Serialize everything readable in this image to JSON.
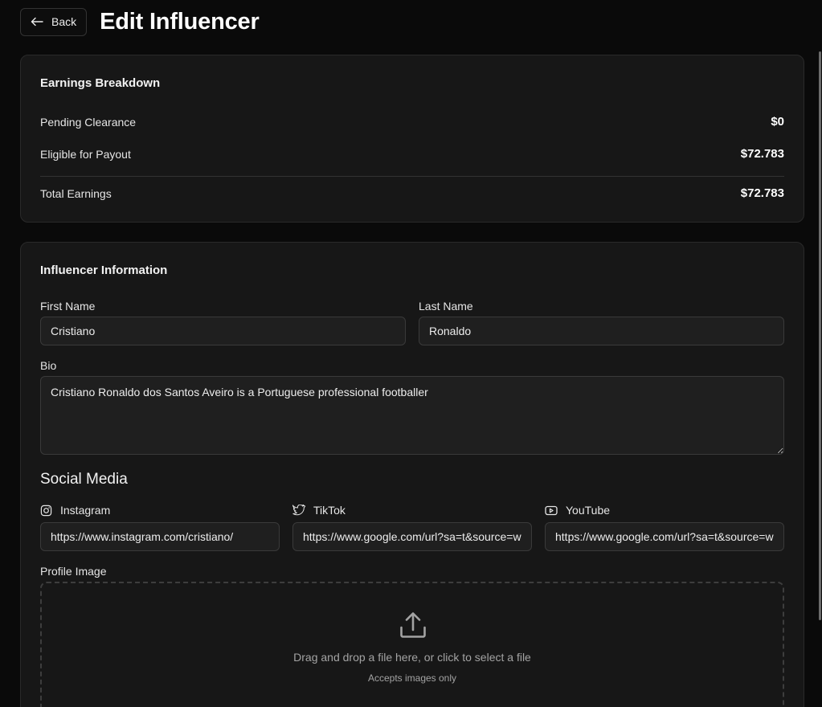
{
  "header": {
    "back_label": "Back",
    "title": "Edit Influencer"
  },
  "earnings": {
    "title": "Earnings Breakdown",
    "rows": [
      {
        "label": "Pending Clearance",
        "value": "$0"
      },
      {
        "label": "Eligible for Payout",
        "value": "$72.783"
      },
      {
        "label": "Total Earnings",
        "value": "$72.783"
      }
    ]
  },
  "info": {
    "title": "Influencer Information",
    "first_name": {
      "label": "First Name",
      "value": "Cristiano"
    },
    "last_name": {
      "label": "Last Name",
      "value": "Ronaldo"
    },
    "bio": {
      "label": "Bio",
      "value": "Cristiano Ronaldo dos Santos Aveiro is a Portuguese professional footballer"
    },
    "social_heading": "Social Media",
    "social": [
      {
        "label": "Instagram",
        "icon": "instagram-icon",
        "value": "https://www.instagram.com/cristiano/"
      },
      {
        "label": "TikTok",
        "icon": "twitter-bird-icon",
        "value": "https://www.google.com/url?sa=t&source=web"
      },
      {
        "label": "YouTube",
        "icon": "youtube-icon",
        "value": "https://www.google.com/url?sa=t&source=web"
      }
    ],
    "profile_image": {
      "label": "Profile Image",
      "drop_text": "Drag and drop a file here, or click to select a file",
      "drop_subtext": "Accepts images only"
    }
  },
  "colors": {
    "background": "#0a0a0a",
    "card": "#171717",
    "input": "#1f1f1f",
    "border": "#333333"
  }
}
